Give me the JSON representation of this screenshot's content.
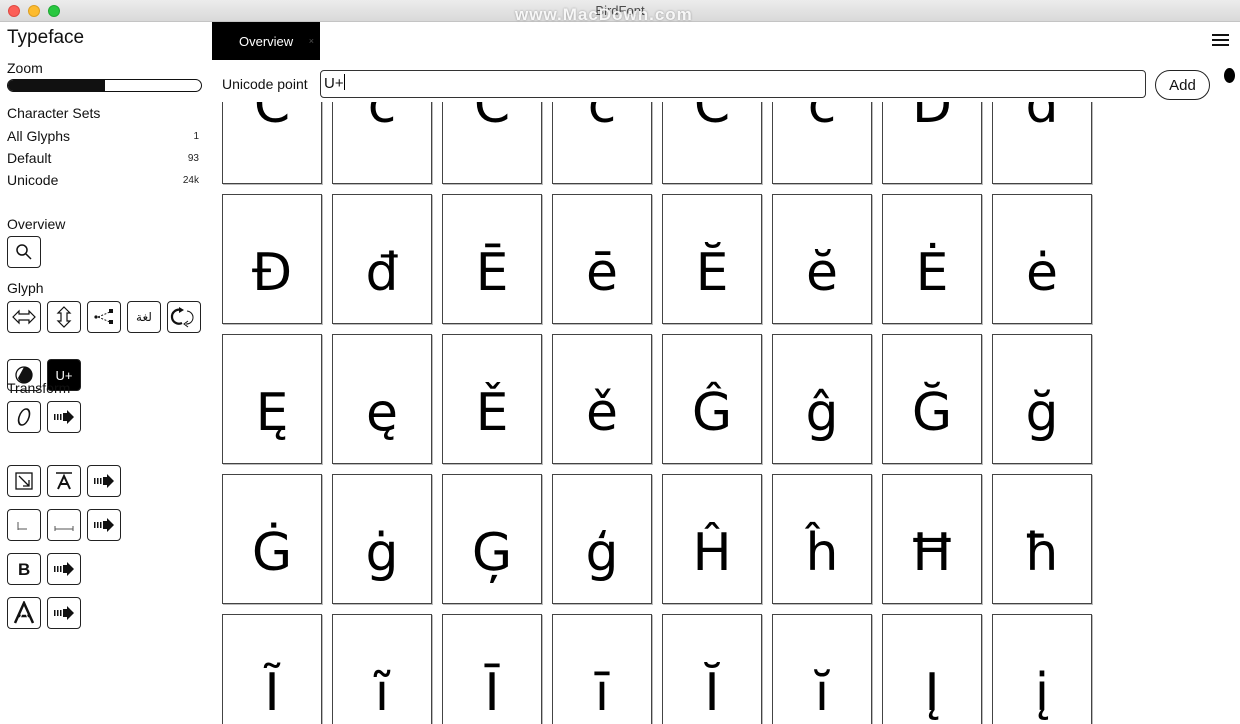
{
  "window": {
    "title": "BirdFont",
    "watermark": "www.MacDown.com"
  },
  "sidebar": {
    "title": "Typeface",
    "zoom_label": "Zoom",
    "zoom_level": 0.5,
    "character_sets_title": "Character Sets",
    "character_sets": [
      {
        "label": "All Glyphs",
        "count": "1"
      },
      {
        "label": "Default",
        "count": "93"
      },
      {
        "label": "Unicode",
        "count": "24k"
      }
    ],
    "overview_label": "Overview",
    "glyph_label": "Glyph",
    "glyph_tools": {
      "ligature_label": "لغة",
      "unicode_label": "U+"
    },
    "transform_label": "Transform"
  },
  "tabs": [
    {
      "label": "Overview",
      "close": "×"
    }
  ],
  "unicode": {
    "label": "Unicode point",
    "value": "U+",
    "add_label": "Add"
  },
  "glyphs": {
    "partial_row": [
      "C",
      "c",
      "C",
      "c",
      "C",
      "c",
      "D",
      "d"
    ],
    "rows": [
      [
        "Đ",
        "đ",
        "Ē",
        "ē",
        "Ĕ",
        "ĕ",
        "Ė",
        "ė"
      ],
      [
        "Ę",
        "ę",
        "Ě",
        "ě",
        "Ĝ",
        "ĝ",
        "Ğ",
        "ğ"
      ],
      [
        "Ġ",
        "ġ",
        "Ģ",
        "ģ",
        "Ĥ",
        "ĥ",
        "Ħ",
        "ħ"
      ],
      [
        "Ĩ",
        "ĩ",
        "Ī",
        "ī",
        "Ĭ",
        "ĭ",
        "Į",
        "į"
      ]
    ]
  }
}
